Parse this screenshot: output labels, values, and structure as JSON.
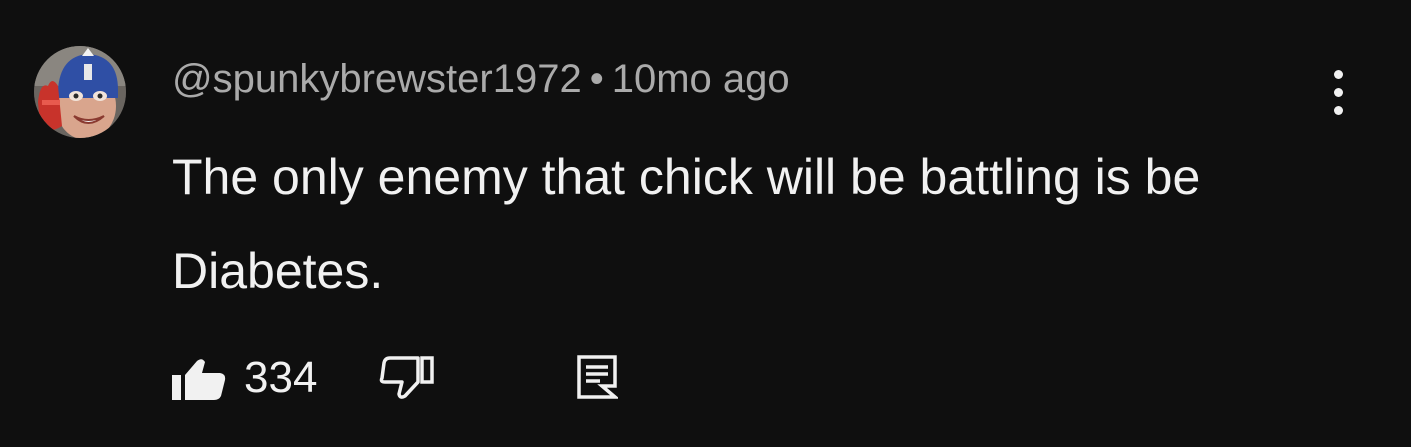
{
  "comment": {
    "author": "@spunkybrewster1972",
    "separator": "•",
    "timestamp": "10mo ago",
    "text": "The only enemy that chick will be battling is be Diabetes.",
    "like_count": "334"
  },
  "icons": {
    "avatar": "captain-america-avatar",
    "like": "thumbs-up-icon",
    "dislike": "thumbs-down-icon",
    "reply": "reply-comment-icon",
    "menu": "more-vert-icon"
  },
  "colors": {
    "background": "#0f0f0f",
    "primary_text": "#f1f1f1",
    "secondary_text": "#aaaaaa"
  }
}
